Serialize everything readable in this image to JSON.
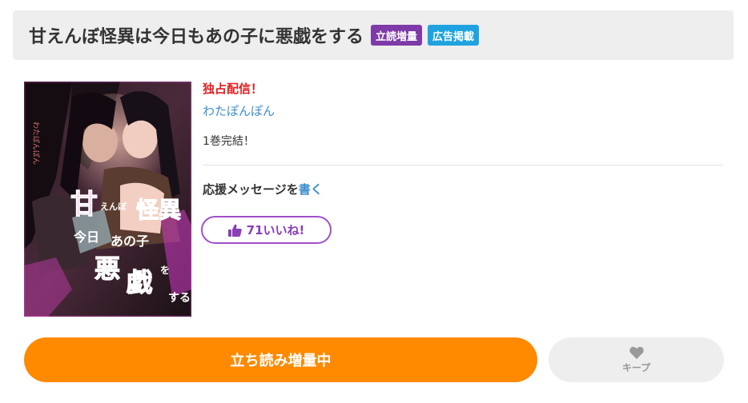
{
  "header": {
    "title": "甘えんぼ怪異は今日もあの子に悪戯をする",
    "badges": [
      {
        "label": "立読増量",
        "color": "#7d3aa8"
      },
      {
        "label": "広告掲載",
        "color": "#1fa3e0"
      }
    ]
  },
  "cover": {
    "icon": "manga-cover-image",
    "title_lettering": "甘えんぼ怪異は今日もあの子に悪戯をする",
    "author_lettering": "わたぽんぽん"
  },
  "info": {
    "exclusive": "独占配信！",
    "author": "わたぽんぽん",
    "volumes": "1巻完結！",
    "support_prefix": "応援メッセージを",
    "support_link": "書く",
    "likes": "71いいね!"
  },
  "actions": {
    "read_label": "立ち読み増量中",
    "keep_label": "キープ"
  },
  "colors": {
    "accent_orange": "#ff8a00",
    "like_purple": "#a04fc9",
    "link_blue": "#3d8fcf",
    "exclusive_red": "#e02020"
  }
}
